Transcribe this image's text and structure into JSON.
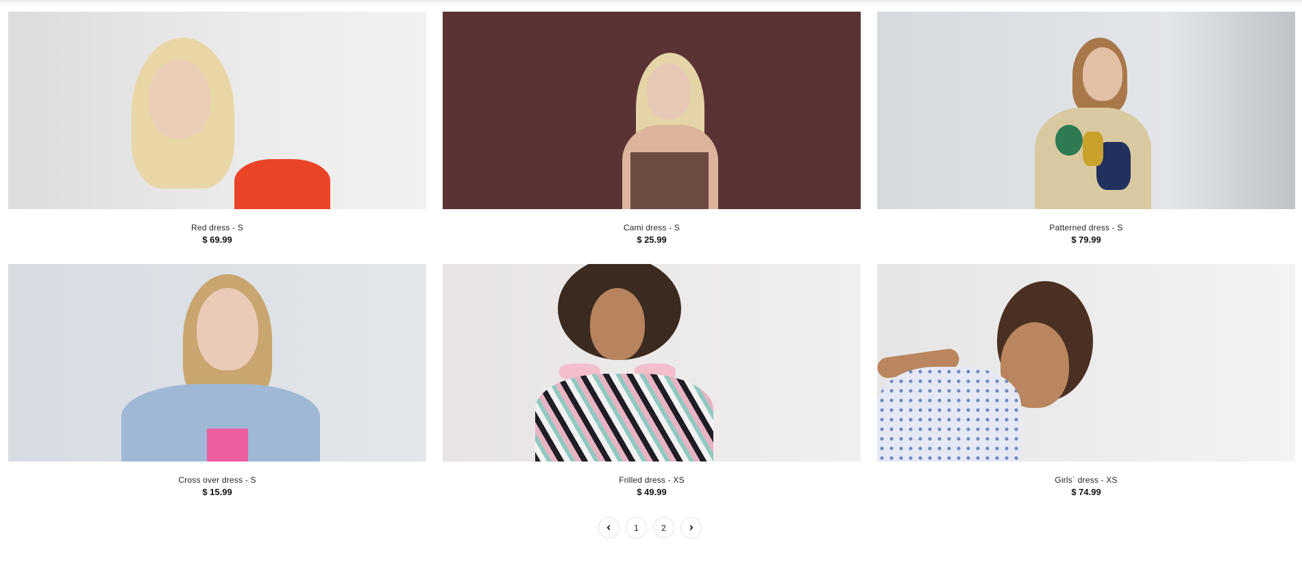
{
  "products": [
    {
      "name": "Red dress - S",
      "price": "$ 69.99"
    },
    {
      "name": "Cami dress - S",
      "price": "$ 25.99"
    },
    {
      "name": "Patterned dress - S",
      "price": "$ 79.99"
    },
    {
      "name": "Cross over dress - S",
      "price": "$ 15.99"
    },
    {
      "name": "Frilled dress - XS",
      "price": "$ 49.99"
    },
    {
      "name": "Girls` dress - XS",
      "price": "$ 74.99"
    }
  ],
  "pagination": {
    "prev_icon": "chevron-left-icon",
    "pages": [
      "1",
      "2"
    ],
    "next_icon": "chevron-right-icon"
  }
}
